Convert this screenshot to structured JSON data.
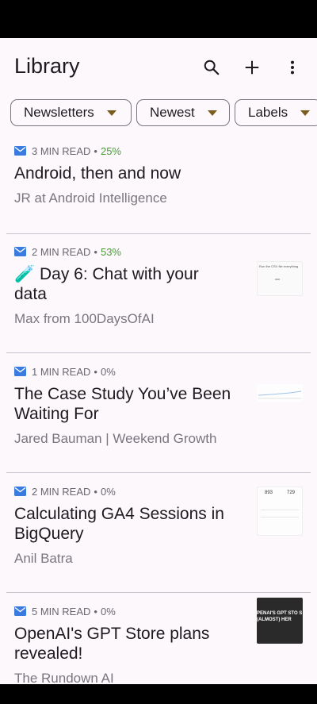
{
  "header": {
    "title": "Library"
  },
  "icons": {
    "search": "search-icon",
    "add": "plus-icon",
    "more": "more-vert-icon",
    "mail": "mail-icon",
    "caret": "caret-down-icon"
  },
  "filters": [
    {
      "label": "Newsletters"
    },
    {
      "label": "Newest"
    },
    {
      "label": "Labels"
    }
  ],
  "colors": {
    "background": "#fdf8fc",
    "accent_mail": "#3a7be0",
    "progress_green": "#4a9a3a",
    "caret": "#7a5c1e"
  },
  "items": [
    {
      "read_time": "3 MIN READ",
      "progress": "25%",
      "title": "Android, then and now",
      "author": "JR at Android Intelligence"
    },
    {
      "read_time": "2 MIN READ",
      "progress": "53%",
      "title": "🧪 Day 6: Chat with your data",
      "author": "Max from 100DaysOfAI",
      "thumb_text": "Run the CSV file everything"
    },
    {
      "read_time": "1 MIN READ",
      "progress": "0%",
      "title": "The Case Study You’ve Been Waiting For",
      "author": "Jared Bauman | Weekend Growth"
    },
    {
      "read_time": "2 MIN READ",
      "progress": "0%",
      "title": "Calculating GA4 Sessions in BigQuery",
      "author": "Anil Batra",
      "thumb_values": [
        "893",
        "729"
      ]
    },
    {
      "read_time": "5 MIN READ",
      "progress": "0%",
      "title": "OpenAI's GPT Store plans revealed!",
      "author": "The Rundown AI",
      "thumb_text": "PENAI'S GPT STO S (ALMOST) HER"
    }
  ]
}
